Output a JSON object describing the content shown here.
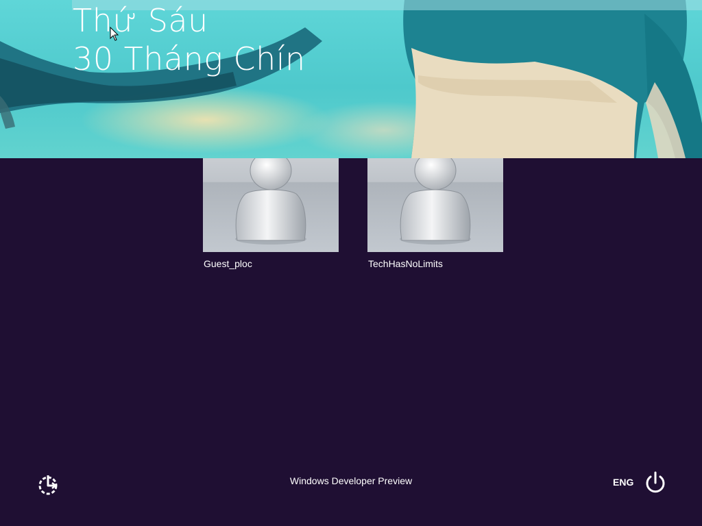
{
  "lock_screen": {
    "day": "Thứ Sáu",
    "date": "30 Tháng Chín"
  },
  "users": [
    {
      "name": "Guest_ploc",
      "avatar_icon": "user-avatar-icon"
    },
    {
      "name": "TechHasNoLimits",
      "avatar_icon": "user-avatar-icon"
    }
  ],
  "footer": {
    "edition": "Windows Developer Preview",
    "language": "ENG",
    "ease_of_access_icon": "ease-of-access-icon",
    "power_icon": "power-icon"
  },
  "colors": {
    "background": "#1f0f33",
    "banner_teal": "#4ec9cc",
    "shirt_teal": "#1f7f8f",
    "text": "#ffffff"
  }
}
